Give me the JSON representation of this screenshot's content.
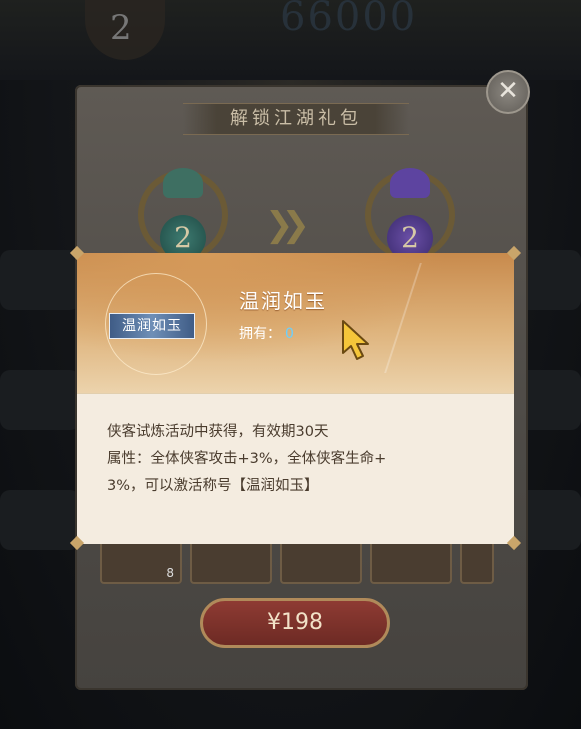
{
  "background": {
    "rank_number": "2",
    "big_number": "66000",
    "panel_title": "解锁江湖礼包",
    "rank_from": "2",
    "rank_to": "2",
    "item_count": "8",
    "price_label": "¥198",
    "close_icon": "close-icon"
  },
  "tooltip": {
    "item_name": "温润如玉",
    "icon_plaque_text": "温润如玉",
    "own_label": "拥有：",
    "own_value": "0",
    "desc_line1": "侠客试炼活动中获得，有效期30天",
    "desc_line2": "属性：全体侠客攻击+3%，全体侠客生命+",
    "desc_line3": "3%，可以激活称号【温润如玉】"
  },
  "colors": {
    "accent_gold": "#c9a56a",
    "own_value": "#6ad0ff",
    "price_button": "#8e3b33"
  }
}
